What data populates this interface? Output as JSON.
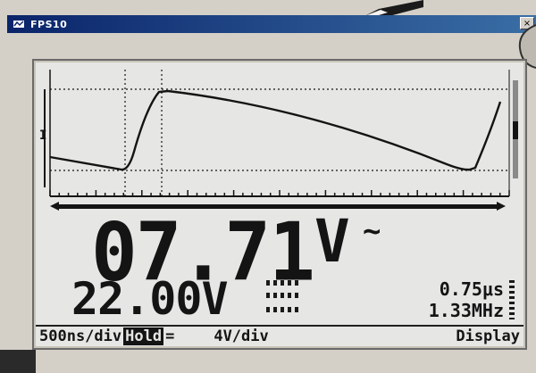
{
  "window": {
    "title": "FPS10",
    "close_label": "×"
  },
  "meter": {
    "main_value": "07.71",
    "main_unit": "V",
    "ac_symbol": "~",
    "secondary_value": "22.00V",
    "period": "0.75μs",
    "frequency": "1.33MHz"
  },
  "status_bar": {
    "timebase": "500ns/div",
    "hold_label": "Hold",
    "equals": "=",
    "volt_div": "4V/div",
    "display_label": "Display"
  },
  "colors": {
    "lcd_bg": "#e6e6e4",
    "ink": "#141414",
    "titlebar": "#0a246a"
  },
  "icons": [
    "app-icon",
    "close-icon",
    "trigger-marker-icon",
    "scroll-arrow-left-icon",
    "scroll-arrow-right-icon"
  ]
}
